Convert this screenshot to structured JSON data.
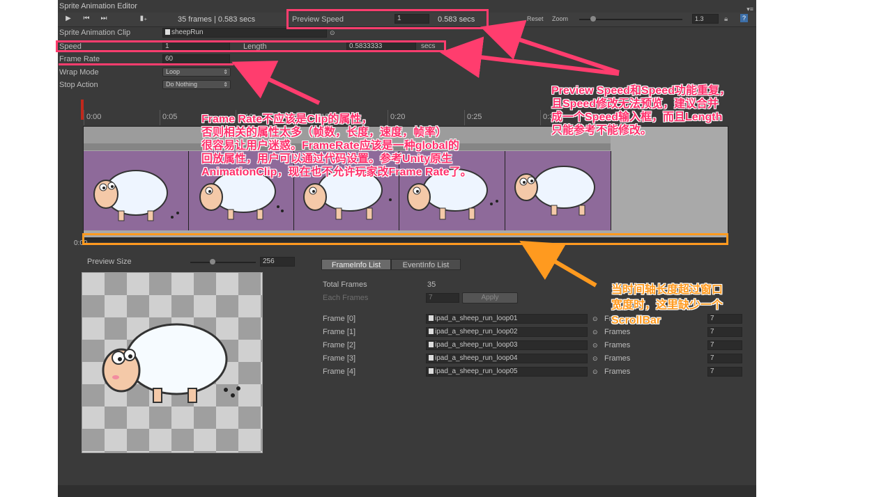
{
  "window": {
    "title": "Sprite Animation Editor"
  },
  "toolbar": {
    "play_icon": "play-icon",
    "prev_icon": "step-back-icon",
    "next_icon": "step-forward-icon",
    "add_icon": "add-keyframe-icon",
    "frames_info": "35 frames | 0.583 secs",
    "preview_speed_label": "Preview Speed",
    "preview_speed_value": "1",
    "preview_speed_secs": "0.583 secs",
    "reset_label": "Reset",
    "zoom_label": "Zoom",
    "zoom_value": "1.3"
  },
  "clip": {
    "clip_label": "Sprite Animation Clip",
    "clip_value": "sheepRun",
    "speed_label": "Speed",
    "speed_value": "1",
    "length_label": "Length",
    "length_value": "0.5833333",
    "length_unit": "secs",
    "frame_rate_label": "Frame Rate",
    "frame_rate_value": "60",
    "wrap_mode_label": "Wrap Mode",
    "wrap_mode_value": "Loop",
    "stop_action_label": "Stop Action",
    "stop_action_value": "Do Nothing"
  },
  "timeline": {
    "ticks": [
      "0:00",
      "0:05",
      "0:10",
      "0:15",
      "0:20",
      "0:25",
      "0:30"
    ],
    "bottom_label": "0:00"
  },
  "preview": {
    "size_label": "Preview Size",
    "size_value": "256"
  },
  "tabs": {
    "frame_info": "FrameInfo List",
    "event_info": "EventInfo List"
  },
  "frame_info": {
    "total_frames_label": "Total Frames",
    "total_frames_value": "35",
    "each_frames_label": "Each Frames",
    "each_frames_value": "7",
    "apply_label": "Apply",
    "frames_col_label": "Frames",
    "rows": [
      {
        "label": "Frame [0]",
        "sprite": "ipad_a_sheep_run_loop01",
        "frames": "7",
        "frames_label": "Fr"
      },
      {
        "label": "Frame [1]",
        "sprite": "ipad_a_sheep_run_loop02",
        "frames": "7",
        "frames_label": "Frames"
      },
      {
        "label": "Frame [2]",
        "sprite": "ipad_a_sheep_run_loop03",
        "frames": "7",
        "frames_label": "Frames"
      },
      {
        "label": "Frame [3]",
        "sprite": "ipad_a_sheep_run_loop04",
        "frames": "7",
        "frames_label": "Frames"
      },
      {
        "label": "Frame [4]",
        "sprite": "ipad_a_sheep_run_loop05",
        "frames": "7",
        "frames_label": "Frames"
      }
    ]
  },
  "annotations": {
    "frame_rate_note": [
      "Frame Rate不应该是Clip的属性，",
      "否则相关的属性太多（帧数，长度，速度，帧率）",
      "很容易让用户迷惑。FrameRate应该是一种global的",
      "回放属性，用户可以通过代码设置。参考Unity原生",
      "AnimationClip，现在也不允许玩家改Frame Rate了。"
    ],
    "speed_note": [
      "Preview Speed和Speed功能重复，",
      "且Speed修改无法预览，建议合并",
      "成一个Speed输入框，而且Length",
      "只能参考不能修改。"
    ],
    "scrollbar_note": [
      "当时间轴长度超过窗口",
      "宽度时，这里缺少一个",
      "ScrollBar"
    ]
  },
  "colors": {
    "annotation_red": "#ff3d6e",
    "annotation_orange": "#ff9a1f",
    "frame_bg": "#8e6a9a"
  }
}
